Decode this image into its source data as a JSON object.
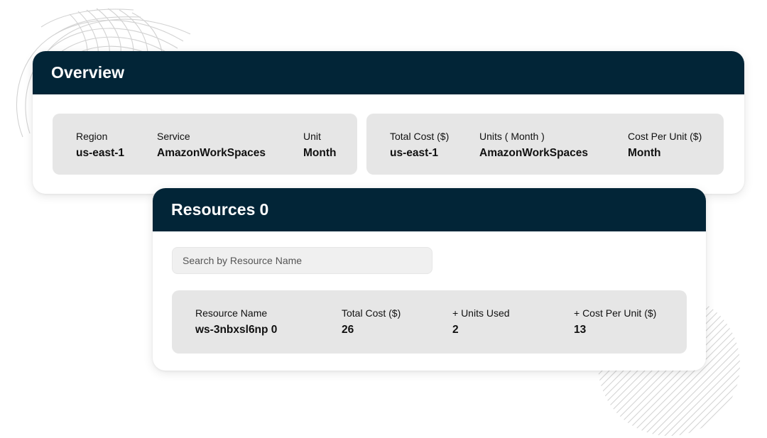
{
  "overview": {
    "title": "Overview",
    "left_box": [
      {
        "label": "Region",
        "value": "us-east-1"
      },
      {
        "label": "Service",
        "value": "AmazonWorkSpaces"
      },
      {
        "label": "Unit",
        "value": "Month"
      }
    ],
    "right_box": [
      {
        "label": "Total Cost ($)",
        "value": "us-east-1"
      },
      {
        "label": "Units ( Month )",
        "value": "AmazonWorkSpaces"
      },
      {
        "label": "Cost Per Unit ($)",
        "value": "Month"
      }
    ]
  },
  "resources": {
    "title": "Resources",
    "count": "0",
    "search": {
      "placeholder": "Search by Resource Name"
    },
    "row": [
      {
        "label": "Resource Name",
        "value": "ws-3nbxsl6np 0"
      },
      {
        "label": "Total Cost ($)",
        "value": "26"
      },
      {
        "label": "+ Units Used",
        "value": "2"
      },
      {
        "label": "+ Cost Per Unit ($)",
        "value": "13"
      }
    ]
  },
  "colors": {
    "header_bg": "#022537",
    "panel_bg": "#e6e6e6",
    "card_bg": "#ffffff"
  }
}
